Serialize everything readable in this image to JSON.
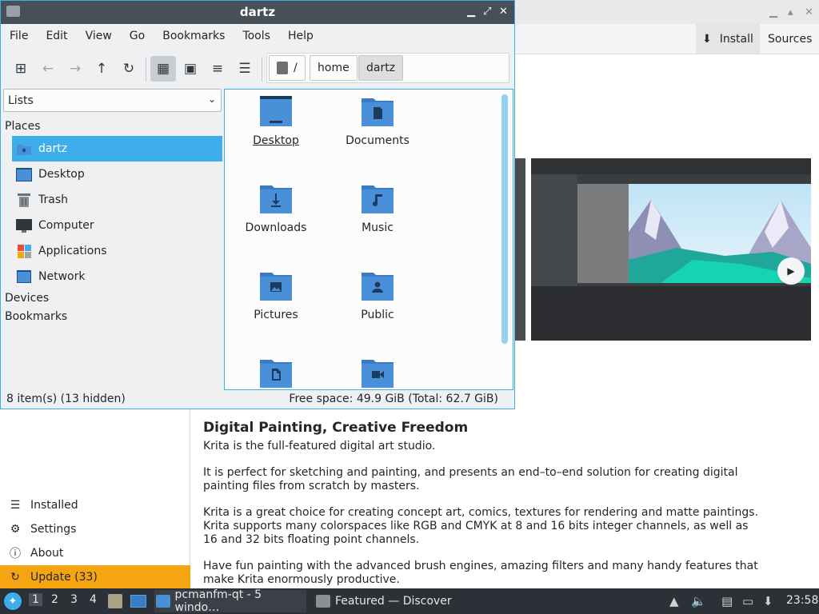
{
  "discover": {
    "toolbar": {
      "install_label": "Install",
      "sources_label": "Sources"
    },
    "nav": [
      {
        "label": "Installed",
        "icon": "list-icon"
      },
      {
        "label": "Settings",
        "icon": "gear-icon"
      },
      {
        "label": "About",
        "icon": "info-icon"
      },
      {
        "label": "Update (33)",
        "icon": "update-icon"
      }
    ],
    "description": {
      "heading": "Digital Painting, Creative Freedom",
      "paragraphs": [
        "Krita is the full-featured digital art studio.",
        "It is perfect for sketching and painting, and presents an end–to–end solution for creating digital painting files from scratch by masters.",
        "Krita is a great choice for creating concept art, comics, textures for rendering and matte paintings. Krita supports many colorspaces like RGB and CMYK at 8 and 16 bits integer channels, as well as 16 and 32 bits floating point channels.",
        "Have fun painting with the advanced brush engines, amazing filters and many handy features that make Krita enormously productive."
      ]
    }
  },
  "filemanager": {
    "title": "dartz",
    "menu": [
      "File",
      "Edit",
      "View",
      "Go",
      "Bookmarks",
      "Tools",
      "Help"
    ],
    "path": {
      "root": "/",
      "crumbs": [
        "home",
        "dartz"
      ]
    },
    "side_combo": "Lists",
    "sections": {
      "places": "Places",
      "devices": "Devices",
      "bookmarks": "Bookmarks"
    },
    "places": [
      {
        "label": "dartz",
        "icon": "home-folder-icon",
        "selected": true
      },
      {
        "label": "Desktop",
        "icon": "desktop-icon"
      },
      {
        "label": "Trash",
        "icon": "trash-icon"
      },
      {
        "label": "Computer",
        "icon": "computer-icon"
      },
      {
        "label": "Applications",
        "icon": "applications-icon"
      },
      {
        "label": "Network",
        "icon": "network-icon"
      }
    ],
    "files": [
      {
        "label": "Desktop",
        "icon": "desktop-folder-icon"
      },
      {
        "label": "Documents",
        "icon": "documents-folder-icon"
      },
      {
        "label": "Downloads",
        "icon": "downloads-folder-icon"
      },
      {
        "label": "Music",
        "icon": "music-folder-icon"
      },
      {
        "label": "Pictures",
        "icon": "pictures-folder-icon"
      },
      {
        "label": "Public",
        "icon": "public-folder-icon"
      },
      {
        "label": "",
        "icon": "templates-folder-icon"
      },
      {
        "label": "",
        "icon": "videos-folder-icon"
      }
    ],
    "status": {
      "items": "8 item(s) (13 hidden)",
      "free": "Free space: 49.9 GiB (Total: 62.7 GiB)"
    }
  },
  "taskbar": {
    "workspaces": [
      "1",
      "2",
      "3",
      "4"
    ],
    "tasks": [
      {
        "label": "pcmanfm-qt - 5 windo…"
      },
      {
        "label": "Featured — Discover"
      }
    ],
    "clock": "23:58"
  },
  "colors": {
    "accent": "#3daee9",
    "titlebar": "#475057",
    "update": "#f6a512",
    "folder": "#4a90d9"
  }
}
